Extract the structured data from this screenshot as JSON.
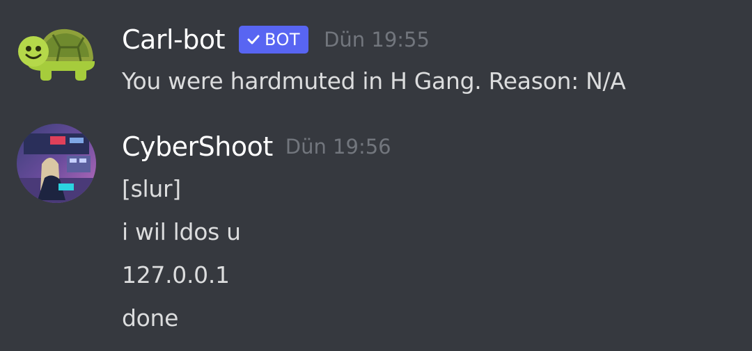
{
  "messages": [
    {
      "author": "Carl-bot",
      "badge": "BOT",
      "timestamp": "Dün 19:55",
      "avatar_icon": "turtle-avatar-icon",
      "lines": [
        "You were hardmuted in H Gang. Reason: N/A"
      ]
    },
    {
      "author": "CyberShoot",
      "timestamp": "Dün 19:56",
      "avatar_icon": "cyberpunk-photo-avatar",
      "lines": [
        "[slur]",
        "i wil ldos u",
        "127.0.0.1",
        "done"
      ]
    }
  ],
  "colors": {
    "background": "#36393f",
    "username": "#ffffff",
    "message_text": "#dcddde",
    "timestamp": "#72767d",
    "bot_badge": "#5865f2",
    "turtle_green": "#a6cc3c"
  }
}
